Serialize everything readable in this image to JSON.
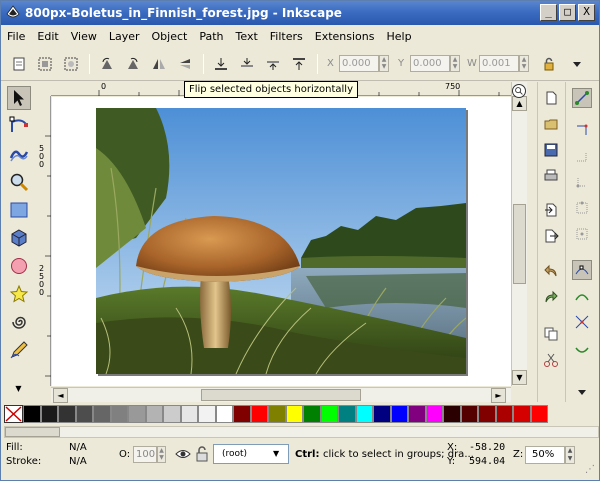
{
  "window": {
    "title": "800px-Boletus_in_Finnish_forest.jpg - Inkscape",
    "buttons": [
      "_",
      "□",
      "X"
    ]
  },
  "menu": [
    "File",
    "Edit",
    "View",
    "Layer",
    "Object",
    "Path",
    "Text",
    "Filters",
    "Extensions",
    "Help"
  ],
  "toolbar": {
    "x_label": "X",
    "x_value": "0.000",
    "y_label": "Y",
    "y_value": "0.000",
    "w_label": "W",
    "w_value": "0.001"
  },
  "tooltip": "Flip selected objects horizontally",
  "rulers": {
    "h_labels": [
      "0",
      "250",
      "500",
      "750"
    ],
    "v_labels": [
      "5",
      "0",
      "0",
      "2",
      "5",
      "0",
      "0"
    ]
  },
  "palette": [
    "#000000",
    "#1a1a1a",
    "#333333",
    "#4d4d4d",
    "#666666",
    "#808080",
    "#999999",
    "#b3b3b3",
    "#cccccc",
    "#e6e6e6",
    "#f2f2f2",
    "#ffffff",
    "#800000",
    "#ff0000",
    "#808000",
    "#ffff00",
    "#008000",
    "#00ff00",
    "#008080",
    "#00ffff",
    "#000080",
    "#0000ff",
    "#800080",
    "#ff00ff",
    "#2b0000",
    "#550000",
    "#800000",
    "#aa0000",
    "#d40000",
    "#ff0000"
  ],
  "status": {
    "fill_label": "Fill:",
    "fill_value": "N/A",
    "stroke_label": "Stroke:",
    "stroke_value": "N/A",
    "opacity_label": "O:",
    "opacity_value": "100",
    "layer_value": "(root)",
    "message_bold": "Ctrl:",
    "message": "click to select in groups; dra...",
    "x_label": "X:",
    "x_value": "-58.20",
    "y_label": "Y:",
    "y_value": "594.04",
    "zoom_label": "Z:",
    "zoom_value": "50%"
  }
}
